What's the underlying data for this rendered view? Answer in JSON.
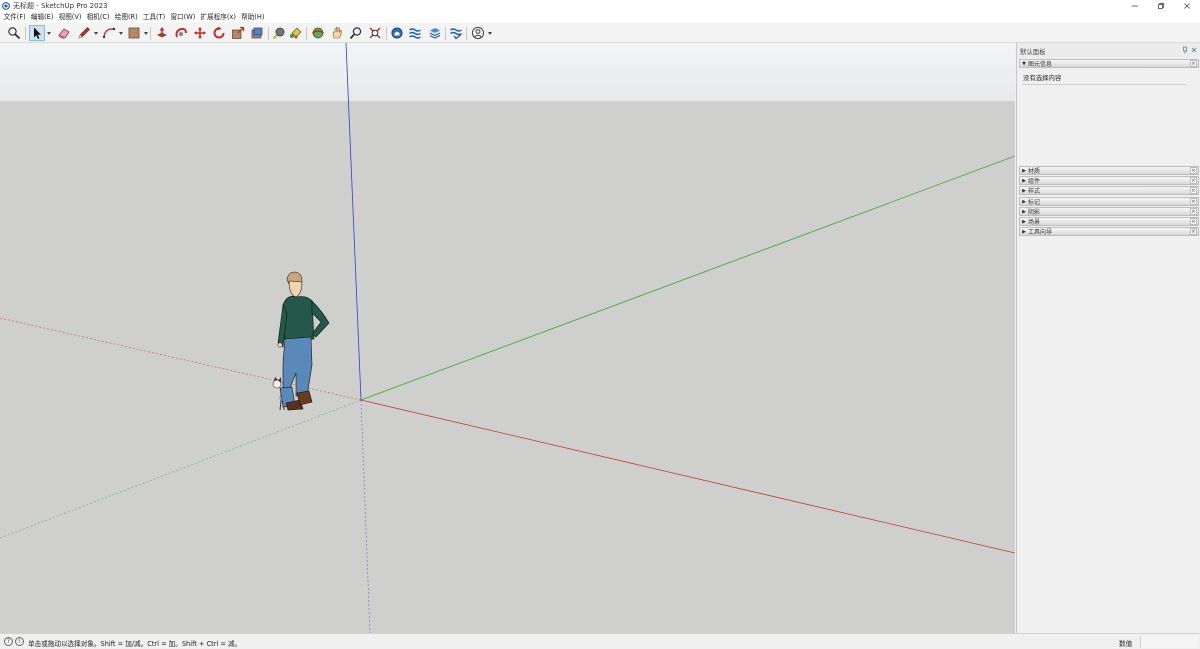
{
  "window": {
    "title": "无标题 - SketchUp Pro 2023",
    "controls": [
      "minimize",
      "restore",
      "close"
    ]
  },
  "menu": [
    "文件(F)",
    "编辑(E)",
    "视图(V)",
    "相机(C)",
    "绘图(R)",
    "工具(T)",
    "窗口(W)",
    "扩展程序(x)",
    "帮助(H)"
  ],
  "toolbar": {
    "tools": [
      {
        "name": "zoom-extents-icon"
      },
      {
        "name": "select-icon",
        "active": true
      },
      {
        "name": "eraser-icon"
      },
      {
        "name": "line-icon"
      },
      {
        "name": "arc-icon"
      },
      {
        "name": "rectangle-icon"
      },
      {
        "name": "push-pull-icon"
      },
      {
        "name": "follow-me-icon"
      },
      {
        "name": "move-icon"
      },
      {
        "name": "rotate-icon"
      },
      {
        "name": "scale-icon"
      },
      {
        "name": "offset-icon"
      },
      {
        "name": "tape-measure-icon"
      },
      {
        "name": "paint-bucket-icon"
      },
      {
        "name": "orbit-icon"
      },
      {
        "name": "pan-icon"
      },
      {
        "name": "zoom-icon"
      },
      {
        "name": "zoom-window-icon"
      },
      {
        "name": "warehouse-icon"
      },
      {
        "name": "extension-warehouse-icon"
      },
      {
        "name": "layout-icon"
      },
      {
        "name": "extension-manager-icon"
      },
      {
        "name": "account-icon"
      }
    ]
  },
  "tray": {
    "title": "默认面板",
    "entity_info": {
      "label": "图元信息",
      "empty_text": "没有选择内容"
    },
    "panels": [
      "材质",
      "组件",
      "样式",
      "标记",
      "阴影",
      "场景",
      "工具向导"
    ]
  },
  "status": {
    "text": "单击或拖动以选择对象。Shift = 加/减。Ctrl = 加。Shift + Ctrl = 减。",
    "measurements_label": "数值",
    "measurements_value": ""
  },
  "colors": {
    "red_axis": "#c23a3a",
    "green_axis": "#3aa63a",
    "blue_axis": "#3a3ac8",
    "ground": "#cfcfcd",
    "sky": "#eceeef",
    "select_highlight": "#cde3f5"
  }
}
